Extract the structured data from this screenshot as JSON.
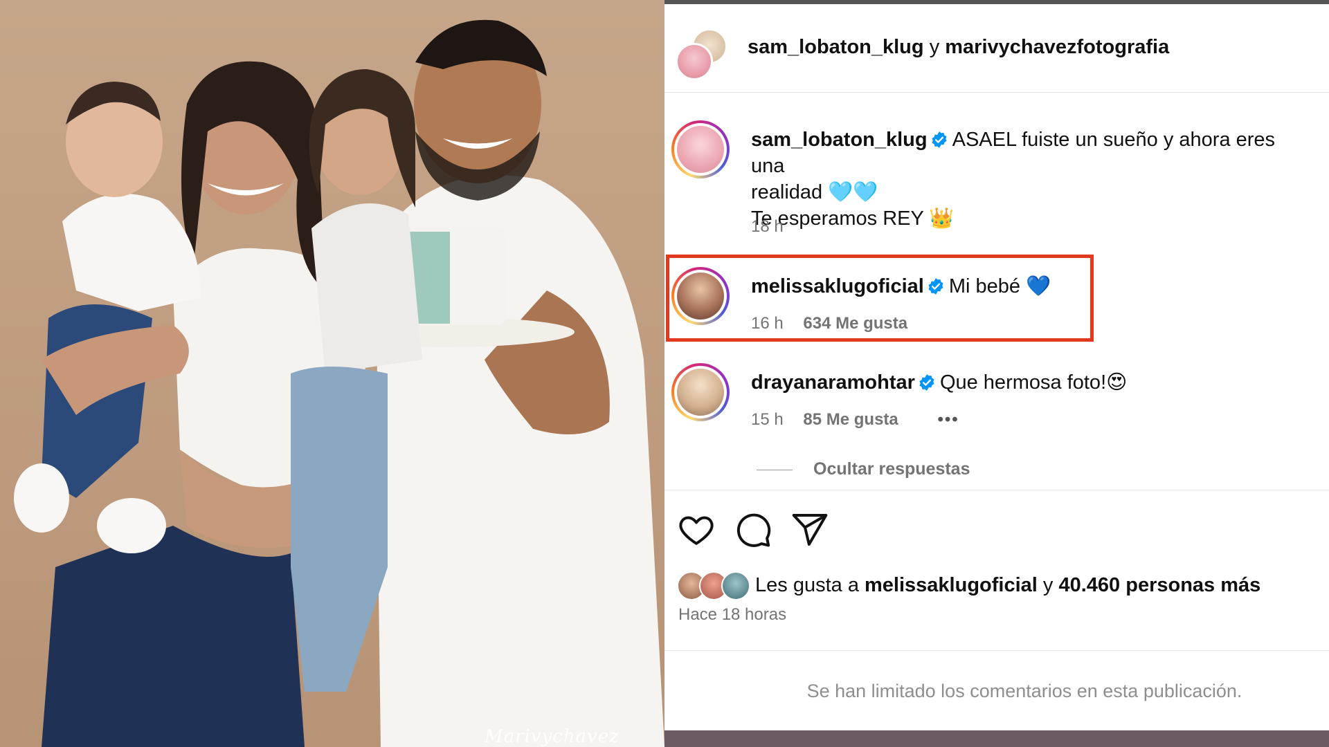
{
  "photo": {
    "watermark": "Marivychavez"
  },
  "post_header": {
    "user1": "sam_lobaton_klug",
    "connector": "y",
    "user2": "marivychavezfotografia"
  },
  "comments": [
    {
      "username": "sam_lobaton_klug",
      "verified": true,
      "text_line1": "ASAEL fuiste un sueño y ahora eres una",
      "text_line2": "realidad 🩵🩵",
      "text_line3": "Te esperamos REY 👑",
      "time": "18 h"
    },
    {
      "username": "melissaklugoficial",
      "verified": true,
      "text": "Mi bebé 💙",
      "time": "16 h",
      "likes": "634 Me gusta",
      "highlighted": true
    },
    {
      "username": "drayanaramohtar",
      "verified": true,
      "text": "Que hermosa foto!😍",
      "time": "15 h",
      "likes": "85 Me gusta",
      "more": "•••"
    }
  ],
  "replies_toggle": "Ocultar respuestas",
  "actions": {
    "like_icon": "heart-icon",
    "comment_icon": "comment-icon",
    "share_icon": "send-icon"
  },
  "likes_summary": {
    "prefix": "Les gusta a",
    "user": "melissaklugoficial",
    "connector": "y",
    "others": "40.460 personas más"
  },
  "posted_ago": "Hace 18 horas",
  "comments_limited": "Se han limitado los comentarios en esta publicación.",
  "colors": {
    "highlight_border": "#e0391f",
    "verified_blue": "#0095f6",
    "meta_gray": "#737373"
  }
}
